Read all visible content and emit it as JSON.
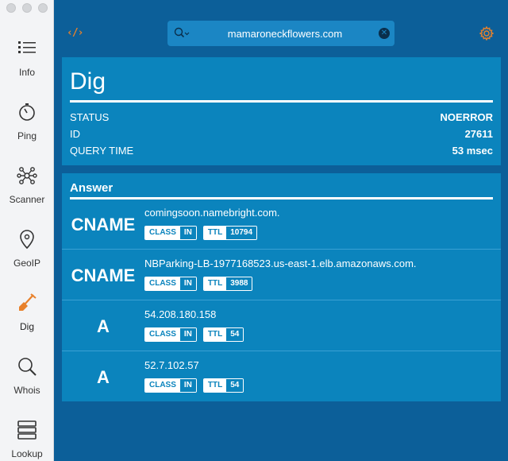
{
  "sidebar": {
    "items": [
      {
        "label": "Info",
        "icon": "list-icon"
      },
      {
        "label": "Ping",
        "icon": "stopwatch-icon"
      },
      {
        "label": "Scanner",
        "icon": "network-nodes-icon"
      },
      {
        "label": "GeoIP",
        "icon": "location-pin-icon"
      },
      {
        "label": "Dig",
        "icon": "shovel-icon",
        "active": true
      },
      {
        "label": "Whois",
        "icon": "magnifier-icon"
      },
      {
        "label": "Lookup",
        "icon": "server-stack-icon"
      }
    ]
  },
  "toolbar": {
    "code_icon_text": "‹/›",
    "search_value": "mamaroneckflowers.com",
    "search_icon": "search-dropdown-icon",
    "clear_icon": "clear-x-icon",
    "settings_icon": "gear-icon"
  },
  "dig": {
    "title": "Dig",
    "stats": [
      {
        "key": "STATUS",
        "value": "NOERROR"
      },
      {
        "key": "ID",
        "value": "27611"
      },
      {
        "key": "QUERY TIME",
        "value": "53 msec"
      }
    ]
  },
  "answer": {
    "title": "Answer",
    "records": [
      {
        "type": "CNAME",
        "value": "comingsoon.namebright.com.",
        "class_label": "CLASS",
        "class_value": "IN",
        "ttl_label": "TTL",
        "ttl_value": "10794"
      },
      {
        "type": "CNAME",
        "value": "NBParking-LB-1977168523.us-east-1.elb.amazonaws.com.",
        "class_label": "CLASS",
        "class_value": "IN",
        "ttl_label": "TTL",
        "ttl_value": "3988"
      },
      {
        "type": "A",
        "value": "54.208.180.158",
        "class_label": "CLASS",
        "class_value": "IN",
        "ttl_label": "TTL",
        "ttl_value": "54"
      },
      {
        "type": "A",
        "value": "52.7.102.57",
        "class_label": "CLASS",
        "class_value": "IN",
        "ttl_label": "TTL",
        "ttl_value": "54"
      }
    ]
  },
  "colors": {
    "background": "#0c5f99",
    "panel": "#0b84bd",
    "accent_orange": "#e8812b",
    "search_bg": "#1b86c4",
    "sidebar_bg": "#f3f4f6"
  }
}
